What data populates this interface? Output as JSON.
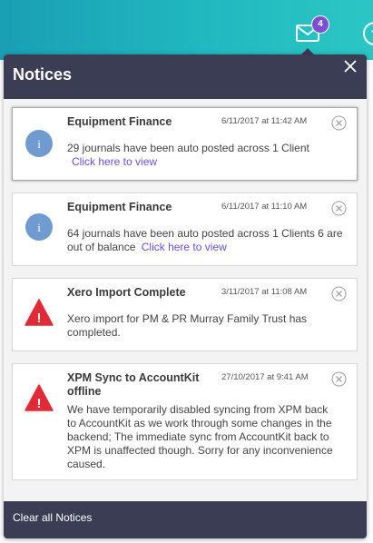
{
  "header": {
    "mail_badge_count": "4",
    "help_glyph": "?"
  },
  "panel": {
    "title": "Notices",
    "clear_all_label": "Clear all Notices"
  },
  "notices": [
    {
      "title": "Equipment Finance",
      "time": "6/11/2017 at 11:42 AM",
      "message": "29 journals have been auto posted across 1 Client",
      "link": "Click here to view",
      "icon": "info-icon"
    },
    {
      "title": "Equipment Finance",
      "time": "6/11/2017 at 11:10 AM",
      "message": "64 journals have been auto posted across 1 Clients 6 are out of balance",
      "link": "Click here to view",
      "icon": "info-icon"
    },
    {
      "title": "Xero Import Complete",
      "time": "3/11/2017 at 11:08 AM",
      "message": "Xero import for PM & PR Murray Family Trust has completed.",
      "icon": "warning-icon"
    },
    {
      "title": "XPM Sync to AccountKit offline",
      "time": "27/10/2017 at 9:41 AM",
      "message": "We have temporarily disabled syncing from XPM back to AccountKit as we work through some changes in the backend; The immediate sync from AccountKit back to XPM is unaffected though. Sorry for any inconvenience caused.",
      "icon": "warning-icon"
    }
  ],
  "colors": {
    "header_bg": "#3b3d55",
    "badge": "#7b4fd0",
    "info_icon": "#6f9bd0",
    "warning_icon": "#e02a36",
    "link": "#6a4fd8"
  }
}
